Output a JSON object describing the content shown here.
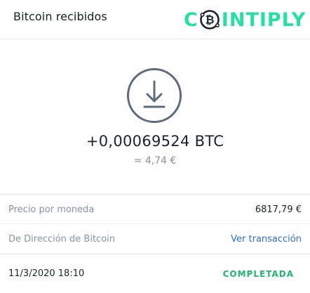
{
  "header": {
    "title": "Bitcoin recibidos",
    "logo": {
      "text_before": "C",
      "text_after": "INTIPLY",
      "coin_icon": "bitcoin-coin-icon",
      "color": "#26e0a0"
    }
  },
  "transaction": {
    "icon": "download-circle-icon",
    "amount": "+0,00069524 BTC",
    "fiat_equivalent": "≈ 4,74 €"
  },
  "details": {
    "price_label": "Precio por moneda",
    "price_value": "6817,79 €",
    "address_label": "De Dirección de Bitcoin",
    "view_link": "Ver transacción"
  },
  "footer": {
    "datetime": "11/3/2020 18:10",
    "status": "COMPLETADA",
    "status_color": "#22b573"
  }
}
